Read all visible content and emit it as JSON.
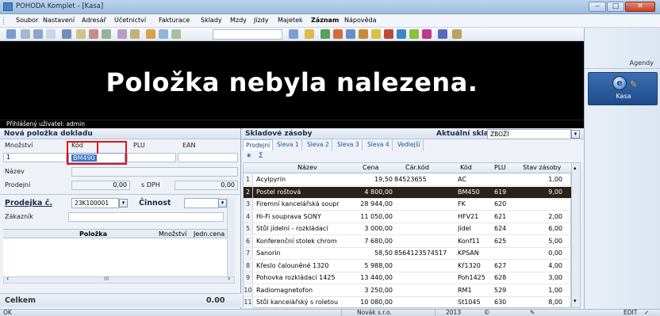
{
  "window": {
    "title": "POHODA Komplet - [Kasa]",
    "min": "‒",
    "max": "□",
    "close": "✕"
  },
  "menu": [
    "Soubor",
    "Nastavení",
    "Adresář",
    "Účetnictví",
    "Fakturace",
    "Sklady",
    "Mzdy",
    "Jízdy",
    "Majetek",
    "Záznam",
    "Nápověda"
  ],
  "display": {
    "message": "Položka nebyla nalezena.",
    "login": "Přihlášený uživatel: admin"
  },
  "agenda": {
    "header": "Agendy",
    "kasa": "Kasa",
    "kasa_icon": "e"
  },
  "form": {
    "title": "Nová položka dokladu",
    "qty_label": "Množství",
    "code_label": "Kód",
    "plu_label": "PLU",
    "ean_label": "EAN",
    "qty_value": "1",
    "code_value": "BM490",
    "name_label": "Název",
    "sale_label": "Prodejní",
    "sale_value": "0,00",
    "vat_label": "s DPH",
    "vat_value": "0,00",
    "doc_label": "Prodejka č.",
    "doc_value": "23K100001",
    "activity_label": "Činnost",
    "customer_label": "Zákazník",
    "items_cols": [
      "Položka",
      "Množství",
      "Jedn.cena"
    ],
    "scroll_mark": "III",
    "total_label": "Celkem",
    "total_value": "0.00"
  },
  "stock": {
    "title": "Skladové zásoby",
    "warehouse_label": "Aktuální sklad",
    "warehouse_value": "ZBOŽÍ",
    "tabs": [
      "Prodejní",
      "Sleva 1",
      "Sleva 2",
      "Sleva 3",
      "Sleva 4",
      "Vedlejší"
    ],
    "filter_star": "∗",
    "filter_sum": "Σ",
    "columns": [
      "Název",
      "Cena",
      "Čár.kód",
      "Kód",
      "PLU",
      "Stav zásoby"
    ],
    "rows": [
      {
        "n": "1",
        "name": "Acylpyrin",
        "price": "19,50",
        "ean": "84523655",
        "code": "AC",
        "plu": "",
        "stock": "1,00"
      },
      {
        "n": "2",
        "name": "Postel roštová",
        "price": "4 800,00",
        "ean": "",
        "code": "BM450",
        "plu": "619",
        "stock": "9,00"
      },
      {
        "n": "3",
        "name": "Firemní kancelářská soupr",
        "price": "28 944,00",
        "ean": "",
        "code": "FK",
        "plu": "620",
        "stock": ""
      },
      {
        "n": "4",
        "name": "Hi-Fi souprava SONY",
        "price": "11 050,00",
        "ean": "",
        "code": "HFV21",
        "plu": "621",
        "stock": "2,00"
      },
      {
        "n": "5",
        "name": "Stůl jídelní - rozkládací",
        "price": "3 000,00",
        "ean": "",
        "code": "Jídel",
        "plu": "624",
        "stock": "6,00"
      },
      {
        "n": "6",
        "name": "Konferenční stolek chrom",
        "price": "7 680,00",
        "ean": "",
        "code": "Konf11",
        "plu": "625",
        "stock": "5,00"
      },
      {
        "n": "7",
        "name": "Sanorin",
        "price": "58,50",
        "ean": "8564123574517",
        "code": "KPSAN",
        "plu": "",
        "stock": "0,00"
      },
      {
        "n": "8",
        "name": "Křeslo čalouněné 1320",
        "price": "5 988,00",
        "ean": "",
        "code": "Kř1320",
        "plu": "627",
        "stock": "4,00"
      },
      {
        "n": "9",
        "name": "Pohovka rozkládací 1425",
        "price": "13 440,00",
        "ean": "",
        "code": "Poh1425",
        "plu": "628",
        "stock": "3,00"
      },
      {
        "n": "10",
        "name": "Radiomagnetofon",
        "price": "3 250,00",
        "ean": "",
        "code": "RM1",
        "plu": "529",
        "stock": "1,00"
      },
      {
        "n": "11",
        "name": "Stůl kancelářský s roletou",
        "price": "10 080,00",
        "ean": "",
        "code": "St1045",
        "plu": "630",
        "stock": "8,00"
      }
    ]
  },
  "status": {
    "left": "OK",
    "company": "Novák s.r.o.",
    "year": "2013",
    "mode": "EDIT"
  },
  "colors": {
    "selected_row": "#2b2118",
    "highlight": "#e0141e",
    "display_bg": "#000000"
  }
}
